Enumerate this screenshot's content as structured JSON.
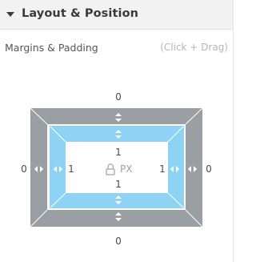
{
  "section": {
    "title": "Layout & Position",
    "collapsed": false
  },
  "margins_padding": {
    "label": "Margins & Padding",
    "hint": "(Click + Drag)",
    "unit": "PX",
    "margin": {
      "top": "0",
      "right": "0",
      "bottom": "0",
      "left": "0"
    },
    "padding": {
      "top": "1",
      "right": "1",
      "bottom": "1",
      "left": "1"
    }
  },
  "colors": {
    "margin_area": "#9a9fa3",
    "padding_area": "#8fd3f4",
    "content_area": "#ffffff",
    "header_bg": "#f2f2f2"
  },
  "icons": {
    "caret": "caret-down-icon",
    "vertical_drag": "vertical-drag-icon",
    "horizontal_drag": "horizontal-drag-icon",
    "lock": "lock-icon"
  }
}
